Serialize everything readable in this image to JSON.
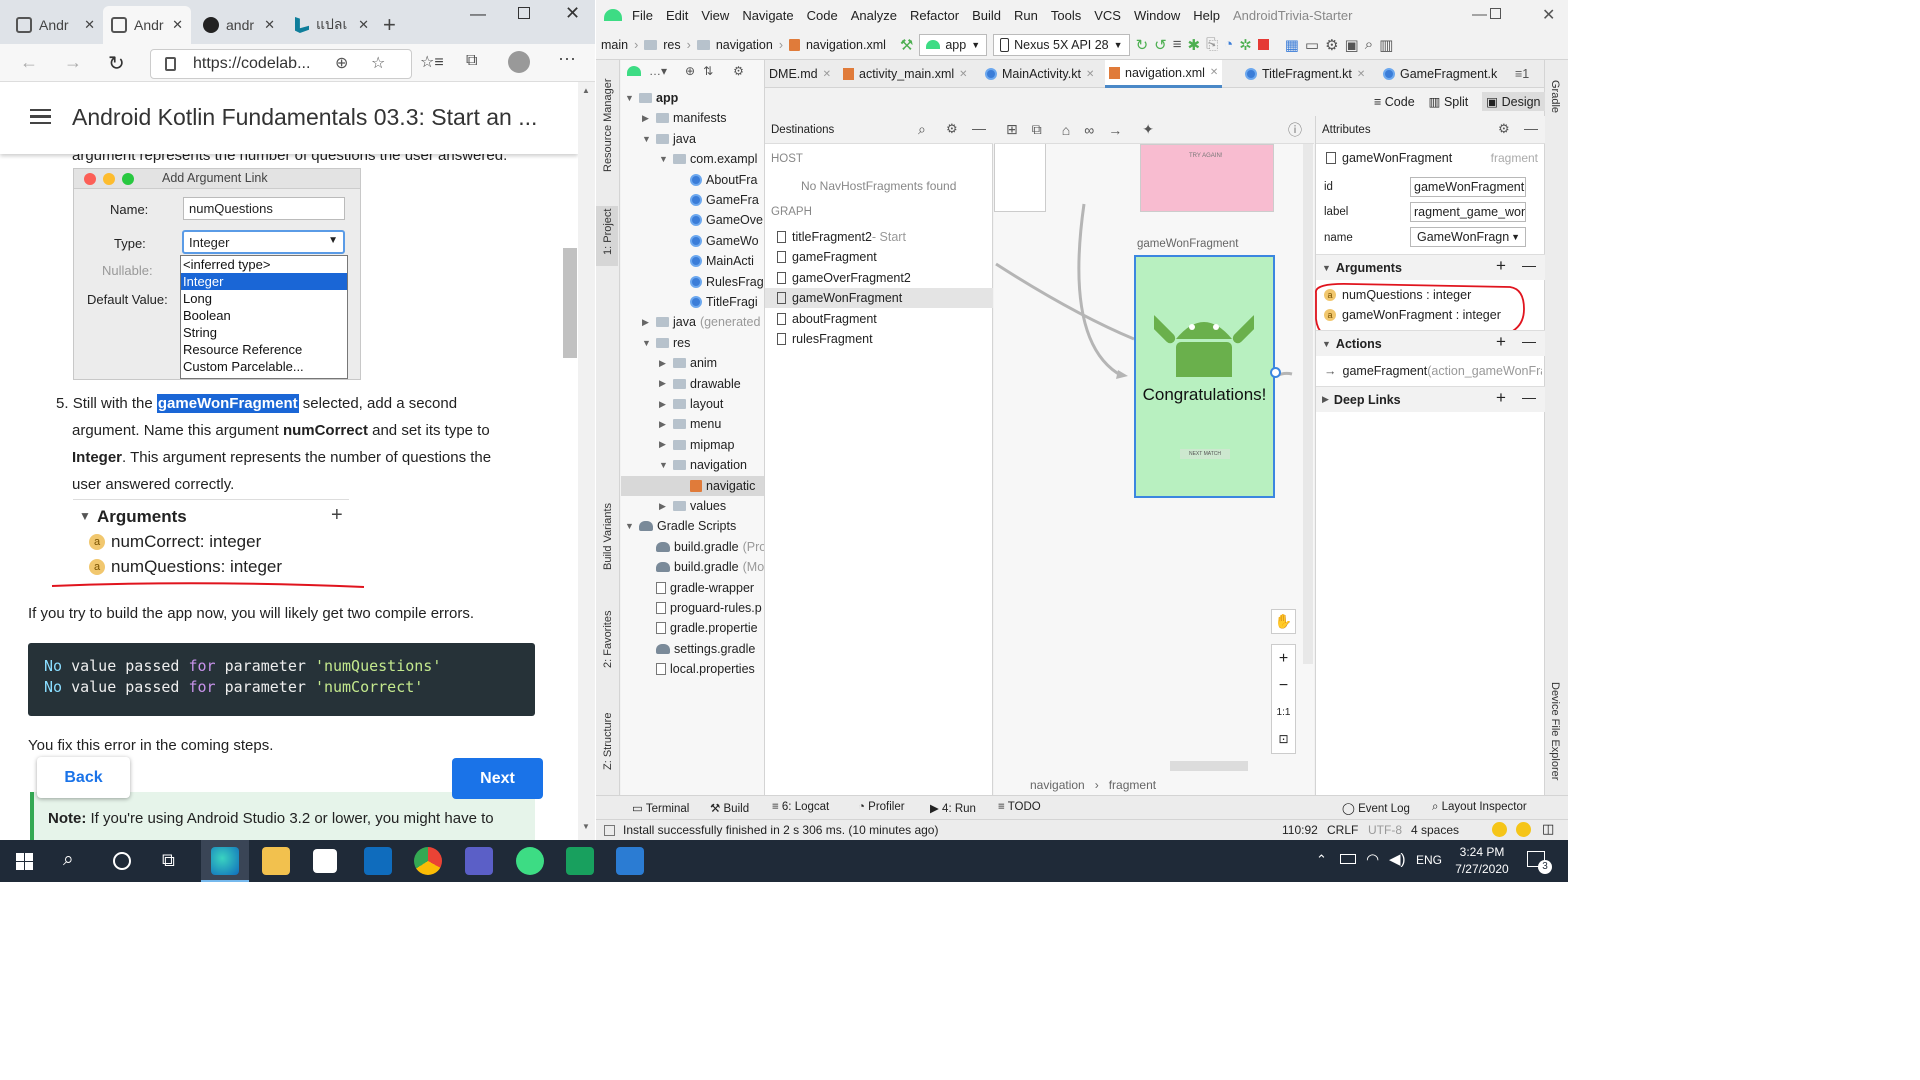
{
  "browser": {
    "tabs": [
      {
        "label": "Andr",
        "close": "✕"
      },
      {
        "label": "Andr",
        "close": "✕"
      },
      {
        "label": "andr",
        "close": "✕"
      },
      {
        "label": "แปลเ",
        "close": "✕"
      }
    ],
    "url": "https://codelab...",
    "page_title": "Android Kotlin Fundamentals 03.3: Start an ...",
    "cut_text": "argument represents the number of questions the user answered.",
    "dialog": {
      "title": "Add Argument Link",
      "name_label": "Name:",
      "name_value": "numQuestions",
      "type_label": "Type:",
      "type_value": "Integer",
      "nullable_label": "Nullable:",
      "default_label": "Default Value:",
      "options": [
        "<inferred type>",
        "Integer",
        "Long",
        "Boolean",
        "String",
        "Resource Reference",
        "Custom Parcelable..."
      ]
    },
    "step5": {
      "number": "5.",
      "t1": "Still with the ",
      "highlight": "gameWonFragment",
      "t2": " selected, add a second",
      "line2a": "argument. Name this argument ",
      "line2b": "numCorrect",
      "line2c": " and set its type to",
      "line3a": "Integer",
      "line3b": ". This argument represents the number of questions the",
      "line4": "user answered correctly."
    },
    "args_panel": {
      "header": "Arguments",
      "plus": "+",
      "items": [
        "numCorrect: integer",
        "numQuestions: integer"
      ]
    },
    "build_text": "If you try to build the app now, you will likely get two compile errors.",
    "code": [
      {
        "a": "No",
        "b": " value passed ",
        "c": "for",
        "d": " parameter ",
        "e": "'numQuestions'"
      },
      {
        "a": "No",
        "b": " value passed ",
        "c": "for",
        "d": " parameter ",
        "e": "'numCorrect'"
      }
    ],
    "fix_text": "You fix this error in the coming steps.",
    "back_label": "Back",
    "next_label": "Next",
    "note_bold": "Note:",
    "note_text": " If you're using Android Studio 3.2 or lower, you might have to"
  },
  "ide": {
    "menus": [
      "File",
      "Edit",
      "View",
      "Navigate",
      "Code",
      "Analyze",
      "Refactor",
      "Build",
      "Run",
      "Tools",
      "VCS",
      "Window",
      "Help"
    ],
    "project_name": "AndroidTrivia-Starter",
    "breadcrumbs": [
      "main",
      "res",
      "navigation",
      "navigation.xml"
    ],
    "run_config": "app",
    "device": "Nexus 5X API 28",
    "left_strip": [
      "Resource Manager",
      "1: Project",
      "Build Variants",
      "2: Favorites",
      "Z: Structure"
    ],
    "right_strip": [
      "Gradle",
      "Device File Explorer"
    ],
    "tree": [
      {
        "label": "app",
        "indent": 0,
        "arrow": "▼",
        "kind": "folder",
        "bold": true
      },
      {
        "label": "manifests",
        "indent": 1,
        "arrow": "▶",
        "kind": "folder"
      },
      {
        "label": "java",
        "indent": 1,
        "arrow": "▼",
        "kind": "folder"
      },
      {
        "label": "com.exampl",
        "indent": 2,
        "arrow": "▼",
        "kind": "folder"
      },
      {
        "label": "AboutFra",
        "indent": 3,
        "arrow": "",
        "kind": "kt"
      },
      {
        "label": "GameFra",
        "indent": 3,
        "arrow": "",
        "kind": "kt"
      },
      {
        "label": "GameOve",
        "indent": 3,
        "arrow": "",
        "kind": "kt"
      },
      {
        "label": "GameWo",
        "indent": 3,
        "arrow": "",
        "kind": "kt"
      },
      {
        "label": "MainActi",
        "indent": 3,
        "arrow": "",
        "kind": "kt"
      },
      {
        "label": "RulesFrag",
        "indent": 3,
        "arrow": "",
        "kind": "kt"
      },
      {
        "label": "TitleFragi",
        "indent": 3,
        "arrow": "",
        "kind": "kt"
      },
      {
        "label": "java (generated",
        "indent": 1,
        "arrow": "▶",
        "kind": "folder"
      },
      {
        "label": "res",
        "indent": 1,
        "arrow": "▼",
        "kind": "folder"
      },
      {
        "label": "anim",
        "indent": 2,
        "arrow": "▶",
        "kind": "folder"
      },
      {
        "label": "drawable",
        "indent": 2,
        "arrow": "▶",
        "kind": "folder"
      },
      {
        "label": "layout",
        "indent": 2,
        "arrow": "▶",
        "kind": "folder"
      },
      {
        "label": "menu",
        "indent": 2,
        "arrow": "▶",
        "kind": "folder"
      },
      {
        "label": "mipmap",
        "indent": 2,
        "arrow": "▶",
        "kind": "folder"
      },
      {
        "label": "navigation",
        "indent": 2,
        "arrow": "▼",
        "kind": "folder"
      },
      {
        "label": "navigatic",
        "indent": 3,
        "arrow": "",
        "kind": "xml",
        "selected": true
      },
      {
        "label": "values",
        "indent": 2,
        "arrow": "▶",
        "kind": "folder"
      },
      {
        "label": "Gradle Scripts",
        "indent": 0,
        "arrow": "▼",
        "kind": "gradle"
      },
      {
        "label": "build.gradle (Pro",
        "indent": 1,
        "arrow": "",
        "kind": "gradle"
      },
      {
        "label": "build.gradle (Mo",
        "indent": 1,
        "arrow": "",
        "kind": "gradle"
      },
      {
        "label": "gradle-wrapper",
        "indent": 1,
        "arrow": "",
        "kind": "file"
      },
      {
        "label": "proguard-rules.p",
        "indent": 1,
        "arrow": "",
        "kind": "file"
      },
      {
        "label": "gradle.propertie",
        "indent": 1,
        "arrow": "",
        "kind": "file"
      },
      {
        "label": "settings.gradle",
        "indent": 1,
        "arrow": "",
        "kind": "gradle"
      },
      {
        "label": "local.properties",
        "indent": 1,
        "arrow": "",
        "kind": "file"
      }
    ],
    "editor_tabs": [
      {
        "label": "DME.md"
      },
      {
        "label": "activity_main.xml"
      },
      {
        "label": "MainActivity.kt"
      },
      {
        "label": "navigation.xml",
        "active": true
      },
      {
        "label": "TitleFragment.kt"
      },
      {
        "label": "GameFragment.k"
      }
    ],
    "tab_overflow": "≡1",
    "view_modes": [
      "Code",
      "Split",
      "Design"
    ],
    "destinations": {
      "header": "Destinations",
      "host_label": "HOST",
      "no_host": "No NavHostFragments found",
      "graph_label": "GRAPH",
      "items": [
        {
          "name": "titleFragment2",
          "suffix": " - Start"
        },
        {
          "name": "gameFragment",
          "suffix": ""
        },
        {
          "name": "gameOverFragment2",
          "suffix": ""
        },
        {
          "name": "gameWonFragment",
          "suffix": "",
          "selected": true
        },
        {
          "name": "aboutFragment",
          "suffix": ""
        },
        {
          "name": "rulesFragment",
          "suffix": ""
        }
      ]
    },
    "canvas": {
      "fragment_label": "gameWonFragment",
      "congrats": "Congratulations!",
      "next_match": "NEXT MATCH",
      "try_again": "TRY AGAIN!",
      "breadcrumb_a": "navigation",
      "breadcrumb_b": "fragment",
      "zoom_fit": "1:1"
    },
    "attributes": {
      "header": "Attributes",
      "selected_name": "gameWonFragment",
      "selected_type": "fragment",
      "id_label": "id",
      "id_value": "gameWonFragment",
      "label_label": "label",
      "label_value": "ragment_game_won",
      "name_label": "name",
      "name_value": "GameWonFragn",
      "arguments_label": "Arguments",
      "arguments": [
        "numQuestions : integer",
        "gameWonFragment : integer"
      ],
      "actions_label": "Actions",
      "action_name": "gameFragment",
      "action_detail": " (action_gameWonFra",
      "deeplinks_label": "Deep Links"
    },
    "bottom_tabs": [
      "Terminal",
      "Build",
      "6: Logcat",
      "Profiler",
      "4: Run",
      "TODO"
    ],
    "bottom_right": [
      "Event Log",
      "Layout Inspector"
    ],
    "status": {
      "message": "Install successfully finished in 2 s 306 ms. (10 minutes ago)",
      "position": "110:92",
      "line_sep": "CRLF",
      "encoding": "UTF-8",
      "indent": "4 spaces"
    }
  },
  "taskbar": {
    "lang": "ENG",
    "time": "3:24 PM",
    "date": "7/27/2020",
    "notifications": "3"
  },
  "colors": {
    "accent_blue": "#1a73e8",
    "annotation_red": "#e0141e",
    "highlight": "#1a66d6",
    "green_screen": "#b8f0c0",
    "android_green": "#6ab04c"
  }
}
